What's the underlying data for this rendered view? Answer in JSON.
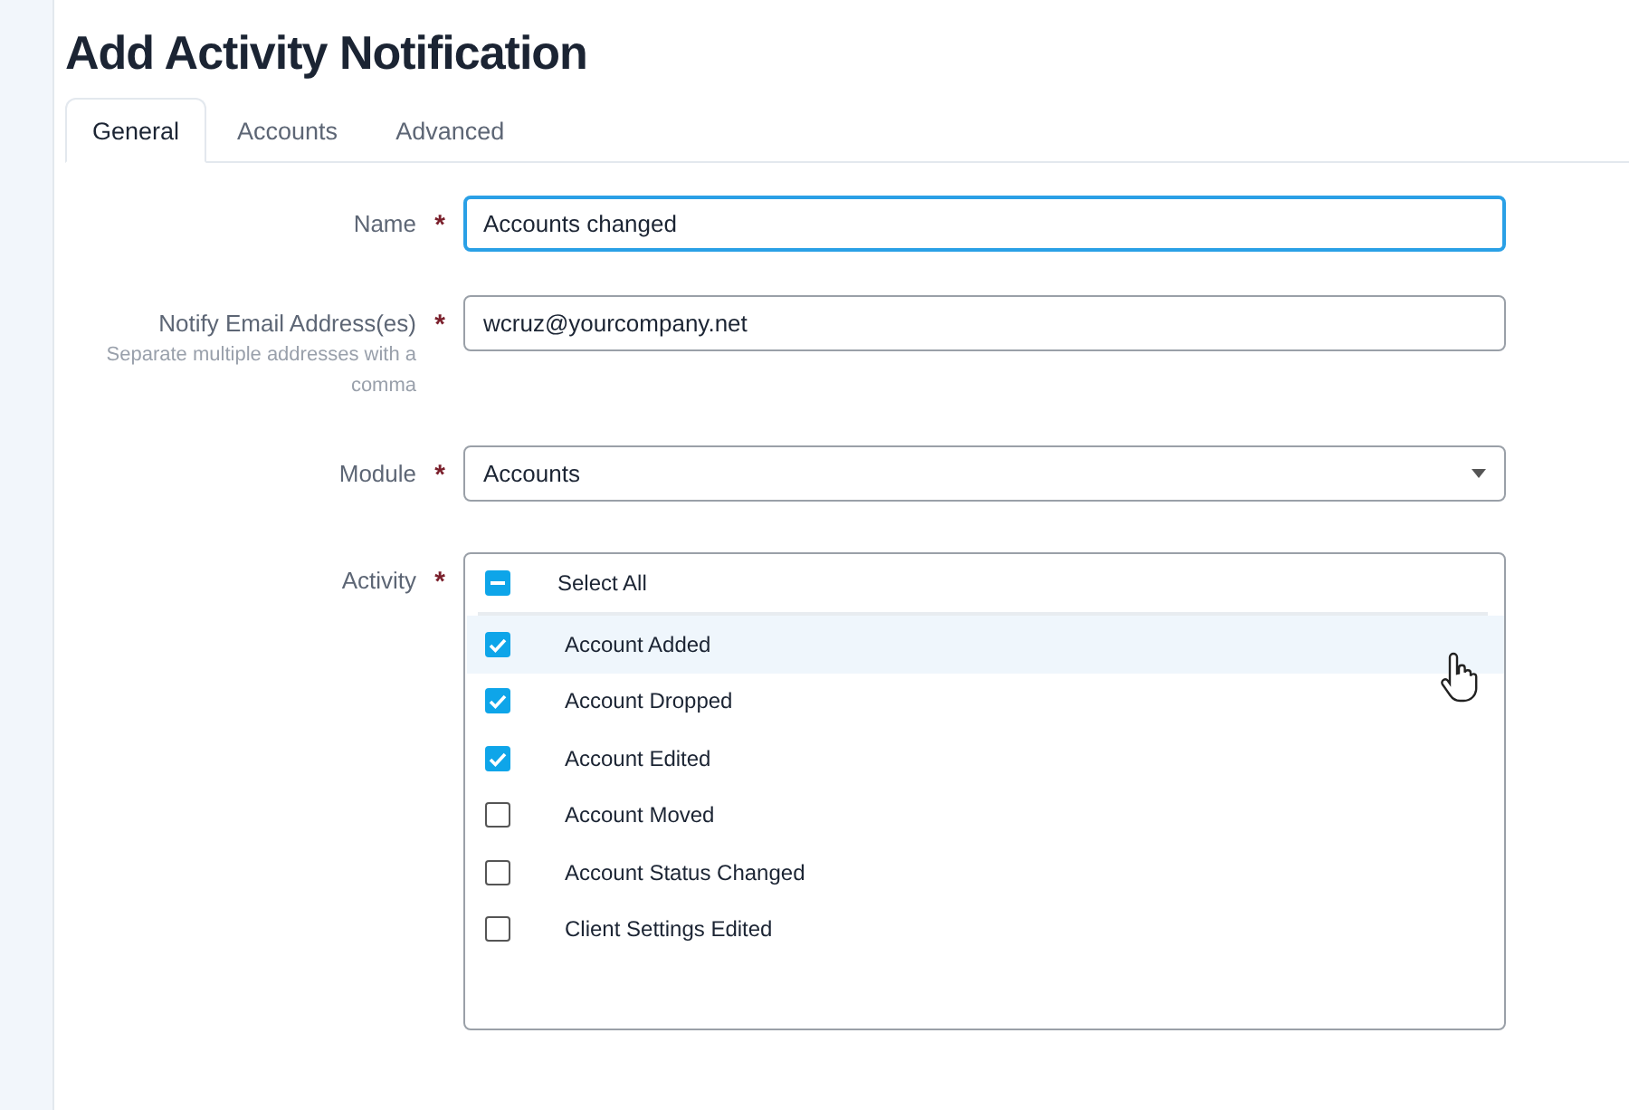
{
  "page_title": "Add Activity Notification",
  "tabs": [
    {
      "label": "General",
      "selected": true
    },
    {
      "label": "Accounts",
      "selected": false
    },
    {
      "label": "Advanced",
      "selected": false
    }
  ],
  "fields": [
    {
      "kind": "text",
      "label": "Name",
      "required_mark": "*",
      "value": "Accounts changed",
      "focused": true
    },
    {
      "kind": "text",
      "label": "Notify Email Address(es)",
      "required_mark": "*",
      "hint": "Separate multiple addresses with a comma",
      "value": "wcruz@yourcompany.net",
      "focused": false
    },
    {
      "kind": "select",
      "label": "Module",
      "required_mark": "*",
      "value": "Accounts",
      "focused": false
    },
    {
      "kind": "checklist",
      "label": "Activity",
      "required_mark": "*",
      "select_all": {
        "label": "Select All",
        "indeterminate": true
      },
      "options": [
        {
          "label": "Account Added",
          "checked": true,
          "highlighted": true
        },
        {
          "label": "Account Dropped",
          "checked": true,
          "highlighted": false
        },
        {
          "label": "Account Edited",
          "checked": true,
          "highlighted": false
        },
        {
          "label": "Account Moved",
          "checked": false,
          "highlighted": false
        },
        {
          "label": "Account Status Changed",
          "checked": false,
          "highlighted": false
        },
        {
          "label": "Client Settings Edited",
          "checked": false,
          "highlighted": false
        }
      ]
    }
  ]
}
